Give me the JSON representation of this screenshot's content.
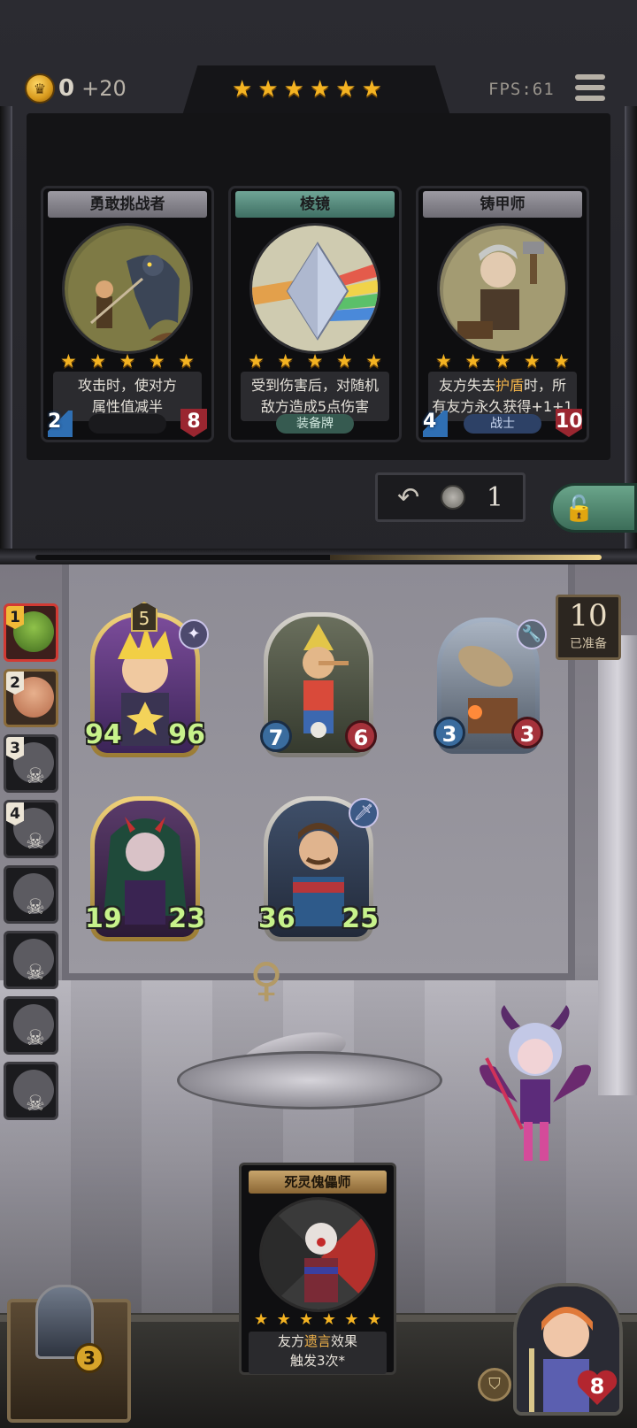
{
  "hud": {
    "coins": "0",
    "coin_gain": "+20",
    "tier_stars": 6,
    "fps": "FPS:61"
  },
  "shop": {
    "cards": [
      {
        "name": "勇敢挑战者",
        "stars": 5,
        "desc_line1": "攻击时，使对方",
        "desc_line2": "属性值减半",
        "attack": "2",
        "health": "8",
        "tag": "",
        "kind": "minion"
      },
      {
        "name": "棱镜",
        "stars": 5,
        "desc_line1": "受到伤害后，对随机",
        "desc_line2": "敌方造成5点伤害",
        "attack": "",
        "health": "",
        "tag": "装备牌",
        "kind": "equip"
      },
      {
        "name": "铸甲师",
        "stars": 5,
        "desc_pre": "友方失去",
        "desc_highlight": "护盾",
        "desc_post": "时，所",
        "desc_line2": "有友方永久获得+1+1",
        "attack": "4",
        "health": "10",
        "tag": "战士",
        "kind": "class"
      }
    ],
    "refresh_cost": "1"
  },
  "players": [
    {
      "rank": "1",
      "state": "active"
    },
    {
      "rank": "2",
      "state": "alive"
    },
    {
      "rank": "3",
      "state": "dead"
    },
    {
      "rank": "4",
      "state": "dead"
    },
    {
      "rank": "",
      "state": "dead"
    },
    {
      "rank": "",
      "state": "dead"
    },
    {
      "rank": "",
      "state": "dead"
    },
    {
      "rank": "",
      "state": "dead"
    }
  ],
  "board": {
    "minions": [
      {
        "attack": "94",
        "health": "96",
        "level": "5",
        "badge": "✦",
        "frame": "gold"
      },
      {
        "attack": "7",
        "health": "6",
        "frame": "silver"
      },
      {
        "attack": "3",
        "health": "3",
        "badge": "🔧",
        "frame": "steel"
      },
      {
        "attack": "19",
        "health": "23",
        "frame": "gold"
      },
      {
        "attack": "36",
        "health": "25",
        "badge": "🗡",
        "frame": "silver"
      }
    ]
  },
  "ready": {
    "count": "10",
    "label": "已准备"
  },
  "hand_card": {
    "name": "死灵傀儡师",
    "stars": 6,
    "desc_pre": "友方",
    "desc_highlight": "遗言",
    "desc_post": "效果",
    "desc_line2": "触发3次*"
  },
  "chest": {
    "count": "3"
  },
  "hero": {
    "health": "8"
  },
  "colors": {
    "accent_gold": "#f4b322",
    "stat_green": "#c7f28b",
    "hp_red": "#b3262f",
    "atk_blue": "#2f6fb3"
  }
}
